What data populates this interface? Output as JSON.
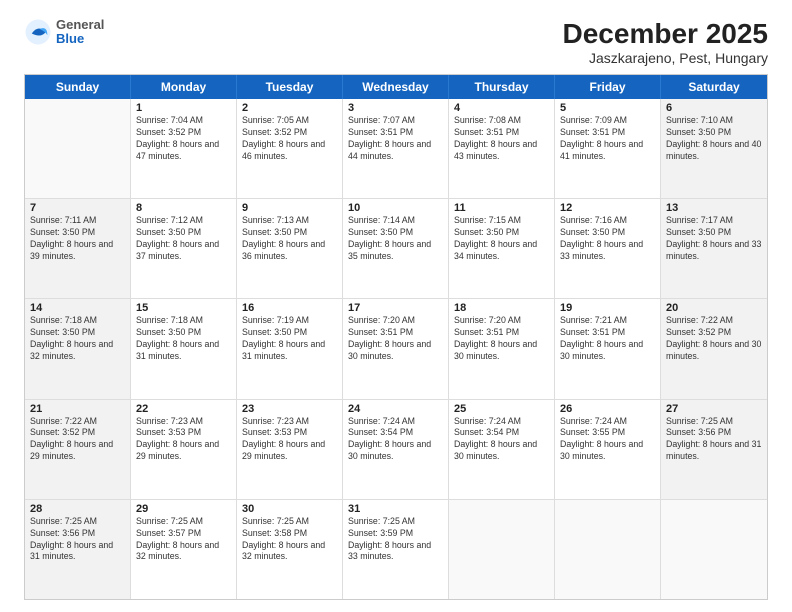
{
  "logo": {
    "general": "General",
    "blue": "Blue"
  },
  "title": "December 2025",
  "subtitle": "Jaszkarajeno, Pest, Hungary",
  "days_of_week": [
    "Sunday",
    "Monday",
    "Tuesday",
    "Wednesday",
    "Thursday",
    "Friday",
    "Saturday"
  ],
  "weeks": [
    [
      {
        "day": "",
        "empty": true
      },
      {
        "day": "1",
        "sunrise": "7:04 AM",
        "sunset": "3:52 PM",
        "daylight": "8 hours and 47 minutes."
      },
      {
        "day": "2",
        "sunrise": "7:05 AM",
        "sunset": "3:52 PM",
        "daylight": "8 hours and 46 minutes."
      },
      {
        "day": "3",
        "sunrise": "7:07 AM",
        "sunset": "3:51 PM",
        "daylight": "8 hours and 44 minutes."
      },
      {
        "day": "4",
        "sunrise": "7:08 AM",
        "sunset": "3:51 PM",
        "daylight": "8 hours and 43 minutes."
      },
      {
        "day": "5",
        "sunrise": "7:09 AM",
        "sunset": "3:51 PM",
        "daylight": "8 hours and 41 minutes."
      },
      {
        "day": "6",
        "sunrise": "7:10 AM",
        "sunset": "3:50 PM",
        "daylight": "8 hours and 40 minutes."
      }
    ],
    [
      {
        "day": "7",
        "sunrise": "7:11 AM",
        "sunset": "3:50 PM",
        "daylight": "8 hours and 39 minutes."
      },
      {
        "day": "8",
        "sunrise": "7:12 AM",
        "sunset": "3:50 PM",
        "daylight": "8 hours and 37 minutes."
      },
      {
        "day": "9",
        "sunrise": "7:13 AM",
        "sunset": "3:50 PM",
        "daylight": "8 hours and 36 minutes."
      },
      {
        "day": "10",
        "sunrise": "7:14 AM",
        "sunset": "3:50 PM",
        "daylight": "8 hours and 35 minutes."
      },
      {
        "day": "11",
        "sunrise": "7:15 AM",
        "sunset": "3:50 PM",
        "daylight": "8 hours and 34 minutes."
      },
      {
        "day": "12",
        "sunrise": "7:16 AM",
        "sunset": "3:50 PM",
        "daylight": "8 hours and 33 minutes."
      },
      {
        "day": "13",
        "sunrise": "7:17 AM",
        "sunset": "3:50 PM",
        "daylight": "8 hours and 33 minutes."
      }
    ],
    [
      {
        "day": "14",
        "sunrise": "7:18 AM",
        "sunset": "3:50 PM",
        "daylight": "8 hours and 32 minutes."
      },
      {
        "day": "15",
        "sunrise": "7:18 AM",
        "sunset": "3:50 PM",
        "daylight": "8 hours and 31 minutes."
      },
      {
        "day": "16",
        "sunrise": "7:19 AM",
        "sunset": "3:50 PM",
        "daylight": "8 hours and 31 minutes."
      },
      {
        "day": "17",
        "sunrise": "7:20 AM",
        "sunset": "3:51 PM",
        "daylight": "8 hours and 30 minutes."
      },
      {
        "day": "18",
        "sunrise": "7:20 AM",
        "sunset": "3:51 PM",
        "daylight": "8 hours and 30 minutes."
      },
      {
        "day": "19",
        "sunrise": "7:21 AM",
        "sunset": "3:51 PM",
        "daylight": "8 hours and 30 minutes."
      },
      {
        "day": "20",
        "sunrise": "7:22 AM",
        "sunset": "3:52 PM",
        "daylight": "8 hours and 30 minutes."
      }
    ],
    [
      {
        "day": "21",
        "sunrise": "7:22 AM",
        "sunset": "3:52 PM",
        "daylight": "8 hours and 29 minutes."
      },
      {
        "day": "22",
        "sunrise": "7:23 AM",
        "sunset": "3:53 PM",
        "daylight": "8 hours and 29 minutes."
      },
      {
        "day": "23",
        "sunrise": "7:23 AM",
        "sunset": "3:53 PM",
        "daylight": "8 hours and 29 minutes."
      },
      {
        "day": "24",
        "sunrise": "7:24 AM",
        "sunset": "3:54 PM",
        "daylight": "8 hours and 30 minutes."
      },
      {
        "day": "25",
        "sunrise": "7:24 AM",
        "sunset": "3:54 PM",
        "daylight": "8 hours and 30 minutes."
      },
      {
        "day": "26",
        "sunrise": "7:24 AM",
        "sunset": "3:55 PM",
        "daylight": "8 hours and 30 minutes."
      },
      {
        "day": "27",
        "sunrise": "7:25 AM",
        "sunset": "3:56 PM",
        "daylight": "8 hours and 31 minutes."
      }
    ],
    [
      {
        "day": "28",
        "sunrise": "7:25 AM",
        "sunset": "3:56 PM",
        "daylight": "8 hours and 31 minutes."
      },
      {
        "day": "29",
        "sunrise": "7:25 AM",
        "sunset": "3:57 PM",
        "daylight": "8 hours and 32 minutes."
      },
      {
        "day": "30",
        "sunrise": "7:25 AM",
        "sunset": "3:58 PM",
        "daylight": "8 hours and 32 minutes."
      },
      {
        "day": "31",
        "sunrise": "7:25 AM",
        "sunset": "3:59 PM",
        "daylight": "8 hours and 33 minutes."
      },
      {
        "day": "",
        "empty": true
      },
      {
        "day": "",
        "empty": true
      },
      {
        "day": "",
        "empty": true
      }
    ]
  ]
}
